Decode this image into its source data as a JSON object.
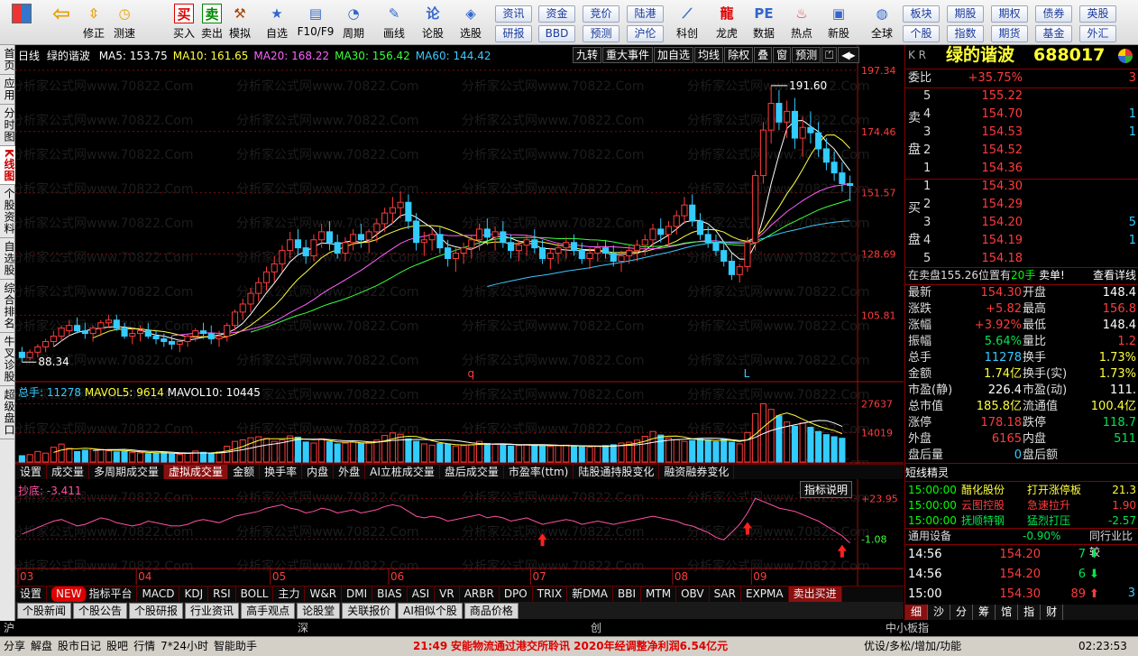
{
  "toolbar": {
    "buttons": [
      "",
      "",
      "修正",
      "测速",
      "买入",
      "卖出",
      "模拟",
      "自选",
      "F10/F9",
      "周期",
      "画线",
      "论股",
      "选股",
      "",
      "科创",
      "龙虎",
      "数据",
      "热点",
      "新股",
      "全球"
    ],
    "small1": [
      [
        "资讯",
        "研报"
      ],
      [
        "资金",
        "BBD"
      ],
      [
        "竞价",
        "预测"
      ],
      [
        "陆港",
        "沪伦"
      ]
    ],
    "small2": [
      [
        "板块",
        "个股"
      ],
      [
        "期股",
        "指数"
      ],
      [
        "期权",
        "期货"
      ],
      [
        "债券",
        "基金"
      ],
      [
        "英股",
        "外汇"
      ]
    ]
  },
  "left_tabs": [
    "首页",
    "应用",
    "分时图",
    "K线图",
    "个股资料",
    "自选股",
    "综合排名",
    "牛叉诊股",
    "超级盘口"
  ],
  "chart": {
    "title": "日线",
    "stock": "绿的谐波",
    "ma": [
      {
        "label": "MA5:",
        "value": "153.75",
        "color": "#ffffff"
      },
      {
        "label": "MA10:",
        "value": "161.65",
        "color": "#ffff3c"
      },
      {
        "label": "MA20:",
        "value": "168.22",
        "color": "#ff60ff"
      },
      {
        "label": "MA30:",
        "value": "156.42",
        "color": "#3cff3c"
      },
      {
        "label": "MA60:",
        "value": "144.42",
        "color": "#3cc8ff"
      }
    ],
    "top_buttons": [
      "九转",
      "重大事件",
      "加自选",
      "均线",
      "除权",
      "叠",
      "窗",
      "预测",
      "⏍",
      "◀▸"
    ],
    "price_axis": [
      "197.34",
      "174.46",
      "151.57",
      "128.69",
      "105.81"
    ],
    "high_label": "191.60",
    "low_label": "88.34",
    "markers": [
      "q",
      "L"
    ],
    "watermark": "分析家公式网www.70822.Com",
    "vol_label": {
      "total": "总手: 11278",
      "ma5": "MAVOL5: 9614",
      "ma10": "MAVOL10: 10445"
    },
    "vol_axis": [
      "27637",
      "14019"
    ],
    "ind_tabs": [
      "设置",
      "成交量",
      "多周期成交量",
      "虚拟成交量",
      "金额",
      "换手率",
      "内盘",
      "外盘",
      "AI立桩成交量",
      "盘后成交量",
      "市盈率(ttm)",
      "陆股通持股变化",
      "融资融券变化"
    ],
    "ind_selected": "虚拟成交量",
    "ind_name": "抄底: -3.411",
    "ind_btn": "指标说明",
    "ind_axis": [
      "+23.95",
      "-1.08"
    ],
    "months": [
      "03",
      "04",
      "05",
      "06",
      "07",
      "08",
      "09"
    ],
    "bottom_tabs": [
      "设置",
      "指标平台",
      "MACD",
      "KDJ",
      "RSI",
      "BOLL",
      "主力",
      "W&R",
      "DMI",
      "BIAS",
      "ASI",
      "VR",
      "ARBR",
      "DPO",
      "TRIX",
      "新DMA",
      "BBI",
      "MTM",
      "OBV",
      "SAR",
      "EXPMA",
      "卖出买进"
    ],
    "new_badge": "NEW",
    "info_tabs": [
      "个股新闻",
      "个股公告",
      "个股研报",
      "行业资讯",
      "高手观点",
      "论股堂",
      "关联报价",
      "AI相似个股",
      "商品价格"
    ]
  },
  "chart_data": {
    "type": "candlestick",
    "price_range": [
      82,
      200
    ],
    "series": [
      {
        "name": "K",
        "values": [
          [
            92,
            94,
            88.34,
            90
          ],
          [
            90,
            93,
            89,
            92
          ],
          [
            92,
            95,
            90,
            94
          ],
          [
            94,
            97,
            92,
            96
          ],
          [
            96,
            100,
            94,
            98
          ],
          [
            98,
            102,
            96,
            101
          ],
          [
            100,
            104,
            98,
            102
          ],
          [
            102,
            105,
            99,
            100
          ],
          [
            100,
            103,
            97,
            99
          ],
          [
            99,
            102,
            96,
            101
          ],
          [
            101,
            104,
            98,
            103
          ],
          [
            103,
            106,
            101,
            104
          ],
          [
            104,
            106,
            100,
            101
          ],
          [
            101,
            103,
            97,
            98
          ],
          [
            98,
            101,
            95,
            99
          ],
          [
            99,
            102,
            96,
            100
          ],
          [
            100,
            103,
            97,
            98
          ],
          [
            98,
            100,
            95,
            97
          ],
          [
            97,
            99,
            94,
            96
          ],
          [
            96,
            98,
            93,
            95
          ],
          [
            95,
            97,
            92,
            96
          ],
          [
            96,
            99,
            94,
            98
          ],
          [
            98,
            101,
            96,
            100
          ],
          [
            100,
            103,
            97,
            99
          ],
          [
            99,
            102,
            95,
            97
          ],
          [
            97,
            100,
            94,
            98
          ],
          [
            98,
            103,
            96,
            102
          ],
          [
            102,
            108,
            100,
            107
          ],
          [
            107,
            112,
            104,
            110
          ],
          [
            110,
            116,
            107,
            114
          ],
          [
            114,
            120,
            111,
            118
          ],
          [
            118,
            124,
            115,
            122
          ],
          [
            122,
            128,
            118,
            125
          ],
          [
            125,
            132,
            122,
            130
          ],
          [
            130,
            137,
            127,
            134
          ],
          [
            134,
            138,
            128,
            131
          ],
          [
            131,
            134,
            125,
            128
          ],
          [
            128,
            136,
            126,
            134
          ],
          [
            134,
            140,
            131,
            137
          ],
          [
            137,
            141,
            130,
            133
          ],
          [
            133,
            136,
            127,
            129
          ],
          [
            129,
            135,
            126,
            133
          ],
          [
            133,
            138,
            130,
            136
          ],
          [
            136,
            140,
            131,
            134
          ],
          [
            134,
            138,
            129,
            137
          ],
          [
            137,
            142,
            133,
            140
          ],
          [
            140,
            146,
            137,
            144
          ],
          [
            144,
            150,
            140,
            146
          ],
          [
            146,
            152,
            142,
            148
          ],
          [
            148,
            151,
            138,
            141
          ],
          [
            141,
            144,
            130,
            133
          ],
          [
            133,
            137,
            128,
            134
          ],
          [
            134,
            138,
            130,
            136
          ],
          [
            136,
            139,
            129,
            131
          ],
          [
            131,
            134,
            124,
            127
          ],
          [
            127,
            131,
            122,
            129
          ],
          [
            129,
            133,
            125,
            131
          ],
          [
            131,
            136,
            127,
            134
          ],
          [
            134,
            140,
            130,
            138
          ],
          [
            138,
            142,
            132,
            135
          ],
          [
            135,
            139,
            130,
            137
          ],
          [
            137,
            141,
            131,
            133
          ],
          [
            133,
            136,
            127,
            130
          ],
          [
            130,
            134,
            126,
            132
          ],
          [
            132,
            136,
            128,
            134
          ],
          [
            134,
            138,
            129,
            131
          ],
          [
            131,
            134,
            125,
            127
          ],
          [
            127,
            131,
            123,
            129
          ],
          [
            129,
            133,
            125,
            131
          ],
          [
            131,
            135,
            127,
            133
          ],
          [
            133,
            136,
            128,
            130
          ],
          [
            130,
            133,
            125,
            127
          ],
          [
            127,
            131,
            123,
            129
          ],
          [
            129,
            133,
            126,
            131
          ],
          [
            131,
            134,
            127,
            129
          ],
          [
            129,
            132,
            124,
            126
          ],
          [
            126,
            130,
            122,
            128
          ],
          [
            128,
            132,
            125,
            130
          ],
          [
            130,
            134,
            126,
            132
          ],
          [
            132,
            136,
            128,
            134
          ],
          [
            134,
            140,
            131,
            138
          ],
          [
            138,
            142,
            133,
            136
          ],
          [
            136,
            141,
            132,
            139
          ],
          [
            139,
            145,
            136,
            143
          ],
          [
            143,
            150,
            140,
            147
          ],
          [
            147,
            151,
            139,
            141
          ],
          [
            141,
            144,
            134,
            136
          ],
          [
            136,
            139,
            131,
            133
          ],
          [
            133,
            136,
            128,
            130
          ],
          [
            130,
            133,
            124,
            126
          ],
          [
            126,
            129,
            119,
            121
          ],
          [
            121,
            125,
            118,
            124
          ],
          [
            124,
            135,
            122,
            133
          ],
          [
            133,
            160,
            130,
            158
          ],
          [
            158,
            178,
            155,
            175
          ],
          [
            175,
            191.6,
            170,
            185
          ],
          [
            185,
            190,
            175,
            178
          ],
          [
            178,
            186,
            172,
            182
          ],
          [
            182,
            187,
            168,
            172
          ],
          [
            172,
            180,
            165,
            176
          ],
          [
            176,
            182,
            170,
            174
          ],
          [
            174,
            178,
            165,
            168
          ],
          [
            168,
            172,
            160,
            163
          ],
          [
            163,
            167,
            156,
            159
          ],
          [
            159,
            163,
            152,
            155
          ],
          [
            155,
            158,
            148.4,
            154.3
          ]
        ]
      }
    ],
    "vol_range": [
      0,
      30000
    ],
    "vol_values": [
      3000,
      3500,
      5000,
      4200,
      7000,
      8500,
      6500,
      5000,
      5600,
      6200,
      6000,
      5300,
      4800,
      5000,
      4600,
      4300,
      4000,
      4200,
      4500,
      3800,
      3600,
      4200,
      5200,
      4600,
      4100,
      4800,
      7500,
      9800,
      10500,
      11500,
      12000,
      11200,
      9800,
      10500,
      12400,
      11800,
      9500,
      9000,
      11000,
      9600,
      8600,
      9000,
      9400,
      8800,
      9200,
      10400,
      12600,
      13800,
      13200,
      11000,
      9800,
      8600,
      8000,
      8800,
      8400,
      7600,
      7800,
      8200,
      9800,
      8800,
      8400,
      8000,
      7600,
      7800,
      8200,
      7900,
      7600,
      7400,
      7800,
      8000,
      7600,
      7200,
      7000,
      7400,
      7800,
      8200,
      9000,
      9400,
      10400,
      12200,
      14500,
      12800,
      11400,
      10600,
      9800,
      10200,
      11000,
      10400,
      9600,
      10800,
      9400,
      8600,
      14000,
      23000,
      27637,
      25000,
      22000,
      19000,
      17000,
      18500,
      16500,
      14500,
      13000,
      12000,
      11278
    ],
    "ind_range": [
      -8,
      28
    ],
    "ind_values": [
      2,
      4,
      6,
      8,
      10,
      11,
      9,
      7,
      8,
      10,
      12,
      11,
      9,
      8,
      7,
      8,
      10,
      9,
      8,
      7,
      7,
      8,
      10,
      11,
      10,
      9,
      11,
      13,
      14,
      15,
      16,
      18,
      19,
      20,
      18,
      17,
      15,
      16,
      18,
      17,
      15,
      16,
      17,
      15,
      16,
      17,
      19,
      20,
      19,
      16,
      13,
      12,
      13,
      12,
      10,
      11,
      12,
      13,
      14,
      12,
      13,
      12,
      10,
      11,
      12,
      10,
      8,
      9,
      10,
      11,
      10,
      8,
      9,
      10,
      9,
      8,
      9,
      10,
      11,
      12,
      13,
      12,
      11,
      10,
      8,
      7,
      5,
      3,
      0,
      -1.5,
      3,
      8,
      15,
      23.95,
      22,
      20,
      18,
      17,
      16,
      14,
      12,
      10,
      7,
      4,
      1,
      -3.411
    ],
    "buy_arrows": [
      66,
      92,
      104
    ]
  },
  "right": {
    "market": "K R",
    "name": "绿的谐波",
    "code": "688017",
    "weibi_label": "委比",
    "weibi_value": "+35.75%",
    "weibi_extra": "3",
    "sell_label": "卖",
    "sell_label2": "盘",
    "buy_label": "买",
    "buy_label2": "盘",
    "asks": [
      {
        "lvl": "5",
        "price": "155.22",
        "vol": ""
      },
      {
        "lvl": "4",
        "price": "154.70",
        "vol": "1"
      },
      {
        "lvl": "3",
        "price": "154.53",
        "vol": "1"
      },
      {
        "lvl": "2",
        "price": "154.52",
        "vol": ""
      },
      {
        "lvl": "1",
        "price": "154.36",
        "vol": ""
      }
    ],
    "bids": [
      {
        "lvl": "1",
        "price": "154.30",
        "vol": ""
      },
      {
        "lvl": "2",
        "price": "154.29",
        "vol": ""
      },
      {
        "lvl": "3",
        "price": "154.20",
        "vol": "5"
      },
      {
        "lvl": "4",
        "price": "154.19",
        "vol": "1"
      },
      {
        "lvl": "5",
        "price": "154.18",
        "vol": ""
      }
    ],
    "pos_text": "在卖盘155.26位置有",
    "pos_vol": "20手",
    "pos_act": "卖单!",
    "pos_link": "查看详线",
    "stats": [
      {
        "l1": "最新",
        "v1": "154.30",
        "c1": "red",
        "l2": "开盘",
        "v2": "148.4",
        "c2": "white"
      },
      {
        "l1": "涨跌",
        "v1": "+5.82",
        "c1": "red",
        "l2": "最高",
        "v2": "156.8",
        "c2": "red"
      },
      {
        "l1": "涨幅",
        "v1": "+3.92%",
        "c1": "red",
        "l2": "最低",
        "v2": "148.4",
        "c2": "white"
      },
      {
        "l1": "振幅",
        "v1": "5.64%",
        "c1": "green",
        "l2": "量比",
        "v2": "1.2",
        "c2": "red"
      },
      {
        "l1": "总手",
        "v1": "11278",
        "c1": "cyan",
        "l2": "换手",
        "v2": "1.73%",
        "c2": "yel"
      },
      {
        "l1": "金额",
        "v1": "1.74亿",
        "c1": "yel",
        "l2": "换手(实)",
        "v2": "1.73%",
        "c2": "yel"
      },
      {
        "l1": "市盈(静)",
        "v1": "226.4",
        "c1": "white",
        "l2": "市盈(动)",
        "v2": "111.",
        "c2": "white"
      },
      {
        "l1": "总市值",
        "v1": "185.8亿",
        "c1": "yel",
        "l2": "流通值",
        "v2": "100.4亿",
        "c2": "yel"
      },
      {
        "l1": "涨停",
        "v1": "178.18",
        "c1": "red",
        "l2": "跌停",
        "v2": "118.7",
        "c2": "green"
      },
      {
        "l1": "外盘",
        "v1": "6165",
        "c1": "red",
        "l2": "内盘",
        "v2": "511",
        "c2": "green"
      },
      {
        "l1": "盘后量",
        "v1": "0",
        "c1": "cyan",
        "l2": "盘后额",
        "v2": "",
        "c2": "white"
      }
    ],
    "elf_title": "短线精灵",
    "elf": [
      {
        "t": "15:00:00",
        "n": "醋化股份",
        "e": "打开涨停板",
        "v": "21.3",
        "c": "yel"
      },
      {
        "t": "15:00:00",
        "n": "云图控股",
        "e": "急速拉升",
        "v": "1.90",
        "c": "red"
      },
      {
        "t": "15:00:00",
        "n": "抚顺特钢",
        "e": "猛烈打压",
        "v": "-2.57",
        "c": "green"
      }
    ],
    "ind_name": "通用设备",
    "ind_pct": "-0.90%",
    "ind_btn": "同行业比较",
    "ticks": [
      {
        "t": "14:56",
        "p": "154.20",
        "v": "7",
        "dir": "down"
      },
      {
        "t": "14:56",
        "p": "154.20",
        "v": "6",
        "dir": "down"
      },
      {
        "t": "15:00",
        "p": "154.30",
        "v": "89",
        "dir": "up"
      }
    ],
    "tick_extra": "3",
    "tabs": [
      "细",
      "沙",
      "分",
      "筹",
      "馆",
      "指",
      "财"
    ]
  },
  "index_bar": {
    "a": "沪",
    "b": "深",
    "c": "创",
    "d": "中小板指"
  },
  "status": {
    "items": [
      "分享",
      "解盘",
      "股市日记",
      "股吧",
      "行情",
      "7*24小时",
      "智能助手"
    ],
    "news_time": "21:49",
    "news": "安能物流通过港交所聆讯 2020年经调整净利润6.54亿元",
    "tail": "优设/多松/增加/功能",
    "clock": "02:23:53"
  }
}
